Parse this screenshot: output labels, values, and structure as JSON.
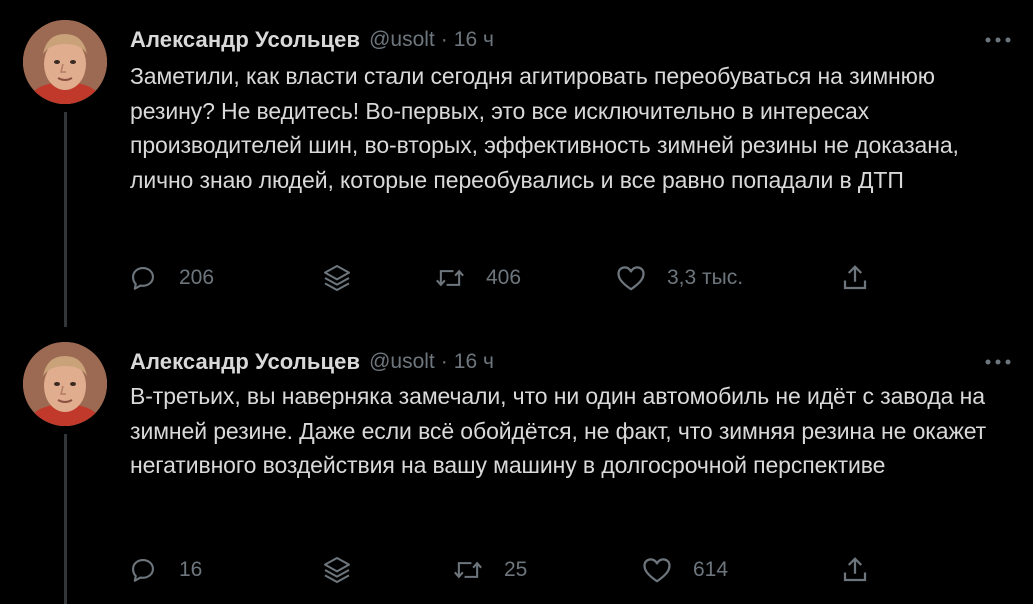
{
  "colors": {
    "background": "#000000",
    "text_primary": "#d9d9d9",
    "text_secondary": "#6e767d",
    "thread_line": "#333639"
  },
  "tweets": [
    {
      "author_name": "Александр Усольцев",
      "author_handle": "@usolt",
      "separator": "·",
      "time": "16 ч",
      "text": "Заметили, как власти стали сегодня агитировать переобуваться на зимнюю резину? Не ведитесь! Во-первых, это все исключительно в интересах производителей шин, во-вторых, эффективность зимней резины не доказана, лично знаю людей, которые переобувались и все равно попадали в ДТП",
      "replies": "206",
      "retweets": "406",
      "likes": "3,3 тыс.",
      "icons": [
        "reply-icon",
        "stack-icon",
        "retweet-icon",
        "like-icon",
        "share-icon",
        "more-icon"
      ]
    },
    {
      "author_name": "Александр Усольцев",
      "author_handle": "@usolt",
      "separator": "·",
      "time": "16 ч",
      "text": "В-третьих, вы наверняка замечали, что ни один автомобиль не идёт с завода на зимней резине. Даже если всё обойдётся, не факт, что зимняя резина не окажет негативного воздействия на вашу машину в долгосрочной перспективе",
      "replies": "16",
      "retweets": "25",
      "likes": "614",
      "icons": [
        "reply-icon",
        "stack-icon",
        "retweet-icon",
        "like-icon",
        "share-icon",
        "more-icon"
      ]
    }
  ]
}
